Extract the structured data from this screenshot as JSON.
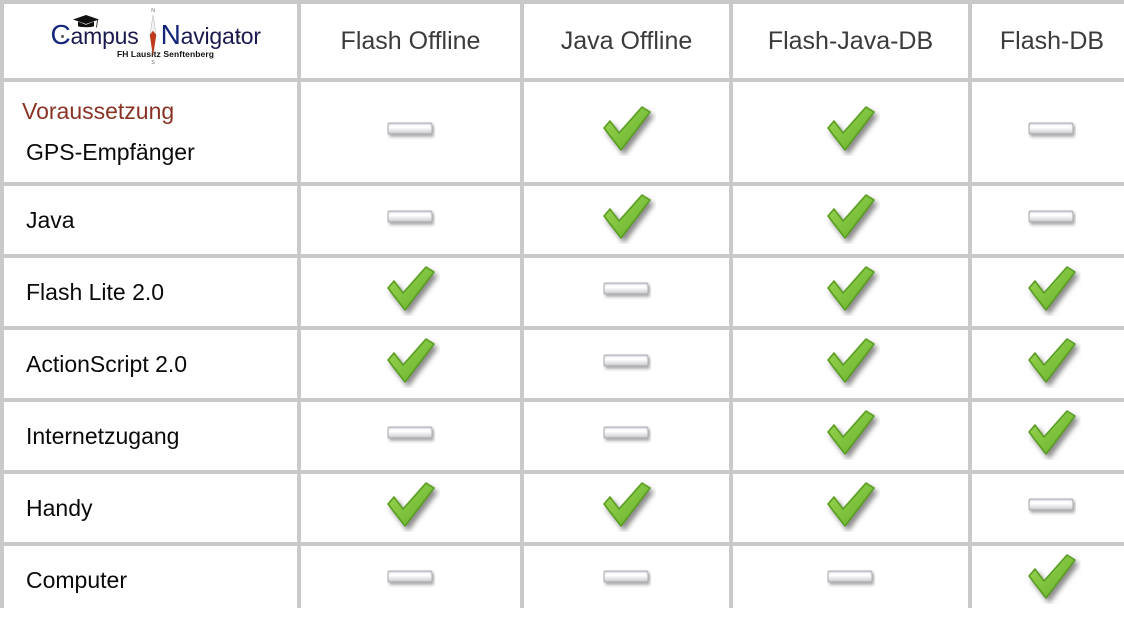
{
  "logo": {
    "name_part1": "Campus",
    "name_part2": "Navigator",
    "subtitle": "FH Lausitz Senftenberg",
    "cap_icon": "graduation-cap-icon",
    "needle_icon": "compass-needle-icon"
  },
  "table": {
    "columns": [
      {
        "label": ""
      },
      {
        "label": "Flash Offline"
      },
      {
        "label": "Java Offline"
      },
      {
        "label": "Flash-Java-DB"
      },
      {
        "label": "Flash-DB"
      }
    ],
    "section_title": "Voraussetzung",
    "rows": [
      {
        "label": "GPS-Empfänger",
        "values": [
          "no",
          "yes",
          "yes",
          "no"
        ]
      },
      {
        "label": "Java",
        "values": [
          "no",
          "yes",
          "yes",
          "no"
        ]
      },
      {
        "label": "Flash Lite 2.0",
        "values": [
          "yes",
          "no",
          "yes",
          "yes"
        ]
      },
      {
        "label": "ActionScript 2.0",
        "values": [
          "yes",
          "no",
          "yes",
          "yes"
        ]
      },
      {
        "label": "Internetzugang",
        "values": [
          "no",
          "no",
          "yes",
          "yes"
        ]
      },
      {
        "label": "Handy",
        "values": [
          "yes",
          "yes",
          "yes",
          "no"
        ]
      },
      {
        "label": "Computer",
        "values": [
          "no",
          "no",
          "no",
          "yes"
        ]
      }
    ]
  },
  "icons": {
    "yes": "green-check-icon",
    "no": "gray-dash-icon"
  },
  "colors": {
    "section_title": "#8a3324",
    "check_green": "#7cc13c",
    "check_green_dark": "#5a9c22",
    "header_text": "#3b3b3b",
    "grid_line": "#c9c9c9",
    "logo_blue": "#15277a"
  }
}
